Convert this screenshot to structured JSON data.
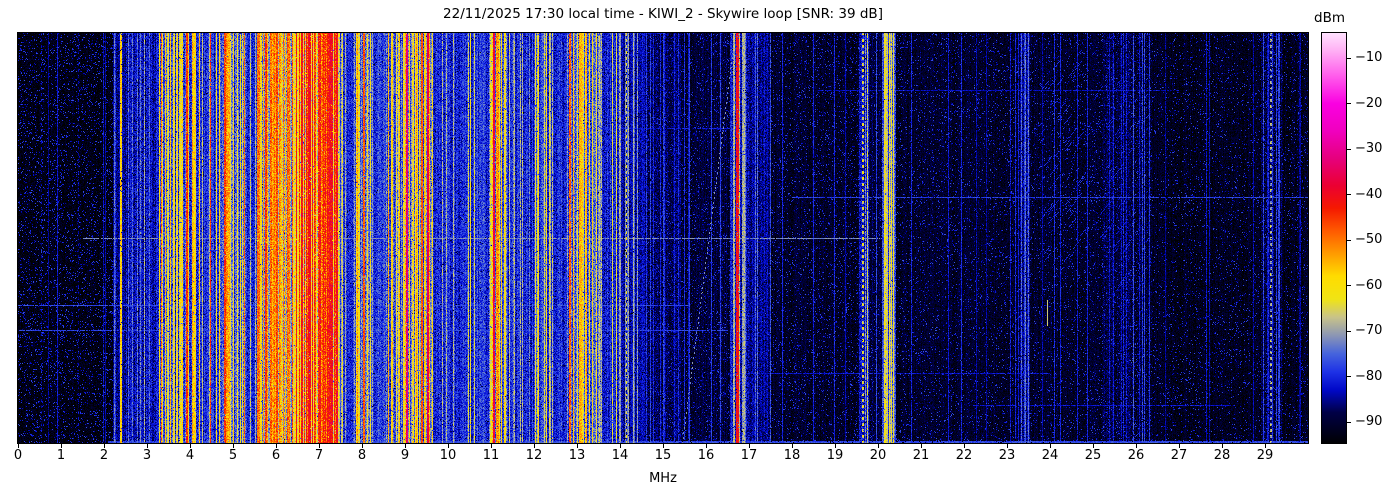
{
  "title": "22/11/2025 17:30 local time - KIWI_2 - Skywire loop [SNR: 39 dB]",
  "xlabel": "MHz",
  "colorbar": {
    "label": "dBm",
    "vmax": -4.5,
    "vmin": -94.6,
    "ticks": [
      {
        "v": -10,
        "label": "−10"
      },
      {
        "v": -20,
        "label": "−20"
      },
      {
        "v": -30,
        "label": "−30"
      },
      {
        "v": -40,
        "label": "−40"
      },
      {
        "v": -50,
        "label": "−50"
      },
      {
        "v": -60,
        "label": "−60"
      },
      {
        "v": -70,
        "label": "−70"
      },
      {
        "v": -80,
        "label": "−80"
      },
      {
        "v": -90,
        "label": "−90"
      }
    ]
  },
  "chart_data": {
    "type": "heatmap",
    "subtype": "radio-spectrogram-waterfall",
    "title": "22/11/2025 17:30 local time - KIWI_2 - Skywire loop [SNR: 39 dB]",
    "xlabel": "MHz",
    "value_label": "dBm",
    "x_range_mhz": [
      0,
      30
    ],
    "x_ticks": [
      0,
      1,
      2,
      3,
      4,
      5,
      6,
      7,
      8,
      9,
      10,
      11,
      12,
      13,
      14,
      15,
      16,
      17,
      18,
      19,
      20,
      21,
      22,
      23,
      24,
      25,
      26,
      27,
      28,
      29
    ],
    "value_range_dbm": [
      -94.6,
      -4.5
    ],
    "seed": 1337,
    "colormap": [
      {
        "v": -95,
        "c": "#000000"
      },
      {
        "v": -88,
        "c": "#000046"
      },
      {
        "v": -83,
        "c": "#0008c8"
      },
      {
        "v": -79,
        "c": "#1e32e6"
      },
      {
        "v": -75,
        "c": "#4664dc"
      },
      {
        "v": -71,
        "c": "#8c96b4"
      },
      {
        "v": -67,
        "c": "#c8c389"
      },
      {
        "v": -63,
        "c": "#f0e414"
      },
      {
        "v": -58,
        "c": "#ffdc00"
      },
      {
        "v": -53,
        "c": "#ff9b00"
      },
      {
        "v": -48,
        "c": "#ff5a00"
      },
      {
        "v": -43,
        "c": "#f51900"
      },
      {
        "v": -38,
        "c": "#eb0032"
      },
      {
        "v": -32,
        "c": "#e6007d"
      },
      {
        "v": -26,
        "c": "#f000be"
      },
      {
        "v": -20,
        "c": "#fa00e1"
      },
      {
        "v": -14,
        "c": "#ff5aeb"
      },
      {
        "v": -8,
        "c": "#ffb4f5"
      },
      {
        "v": -4,
        "c": "#ffe6ff"
      }
    ],
    "bands": [
      {
        "f0": 0.0,
        "f1": 2.2,
        "base": -93,
        "spread": 2,
        "density": 0.03,
        "line": -82,
        "line_var": 6,
        "v_noise": 3,
        "speckle": 0.1
      },
      {
        "f0": 2.2,
        "f1": 2.5,
        "base": -85,
        "spread": 5,
        "density": 0.12,
        "line": -77,
        "line_var": 6,
        "v_noise": 4,
        "speckle": 0.15
      },
      {
        "f0": 2.5,
        "f1": 3.25,
        "base": -83,
        "spread": 6,
        "density": 0.18,
        "line": -74,
        "line_var": 8,
        "v_noise": 5,
        "speckle": 0.15
      },
      {
        "f0": 3.25,
        "f1": 4.25,
        "base": -77,
        "spread": 8,
        "density": 0.48,
        "line": -60,
        "line_var": 14,
        "v_noise": 6,
        "speckle": 0.1
      },
      {
        "f0": 4.25,
        "f1": 4.65,
        "base": -80,
        "spread": 6,
        "density": 0.22,
        "line": -64,
        "line_var": 10,
        "v_noise": 5,
        "speckle": 0.1
      },
      {
        "f0": 4.65,
        "f1": 5.3,
        "base": -76,
        "spread": 8,
        "density": 0.42,
        "line": -58,
        "line_var": 16,
        "v_noise": 6,
        "speckle": 0.1
      },
      {
        "f0": 5.3,
        "f1": 5.55,
        "base": -80,
        "spread": 5,
        "density": 0.15,
        "line": -66,
        "line_var": 8,
        "v_noise": 5,
        "speckle": 0.1
      },
      {
        "f0": 5.55,
        "f1": 6.35,
        "base": -70,
        "spread": 8,
        "density": 0.6,
        "line": -55,
        "line_var": 14,
        "v_noise": 6,
        "speckle": 0.08
      },
      {
        "f0": 6.35,
        "f1": 7.45,
        "base": -62,
        "spread": 10,
        "density": 0.68,
        "line": -46,
        "line_var": 12,
        "v_noise": 6,
        "speckle": 0.08
      },
      {
        "f0": 7.45,
        "f1": 7.78,
        "base": -80,
        "spread": 6,
        "density": 0.18,
        "line": -66,
        "line_var": 8,
        "v_noise": 5,
        "speckle": 0.1
      },
      {
        "f0": 7.78,
        "f1": 8.2,
        "base": -74,
        "spread": 8,
        "density": 0.45,
        "line": -58,
        "line_var": 12,
        "v_noise": 6,
        "speckle": 0.08
      },
      {
        "f0": 8.2,
        "f1": 8.55,
        "base": -79,
        "spread": 7,
        "density": 0.25,
        "line": -66,
        "line_var": 10,
        "v_noise": 5,
        "speckle": 0.1
      },
      {
        "f0": 8.55,
        "f1": 9.1,
        "base": -75,
        "spread": 8,
        "density": 0.45,
        "line": -59,
        "line_var": 13,
        "v_noise": 6,
        "speckle": 0.08
      },
      {
        "f0": 9.1,
        "f1": 9.65,
        "base": -74,
        "spread": 8,
        "density": 0.5,
        "line": -58,
        "line_var": 13,
        "v_noise": 6,
        "speckle": 0.08
      },
      {
        "f0": 9.65,
        "f1": 10.4,
        "base": -80,
        "spread": 6,
        "density": 0.15,
        "line": -70,
        "line_var": 6,
        "v_noise": 5,
        "speckle": 0.12
      },
      {
        "f0": 10.4,
        "f1": 10.95,
        "base": -79,
        "spread": 7,
        "density": 0.25,
        "line": -64,
        "line_var": 10,
        "v_noise": 5,
        "speckle": 0.12
      },
      {
        "f0": 10.95,
        "f1": 11.35,
        "base": -75,
        "spread": 8,
        "density": 0.45,
        "line": -58,
        "line_var": 13,
        "v_noise": 6,
        "speckle": 0.08
      },
      {
        "f0": 11.35,
        "f1": 12.0,
        "base": -80,
        "spread": 6,
        "density": 0.15,
        "line": -70,
        "line_var": 8,
        "v_noise": 5,
        "speckle": 0.12
      },
      {
        "f0": 12.0,
        "f1": 12.3,
        "base": -78,
        "spread": 7,
        "density": 0.3,
        "line": -64,
        "line_var": 10,
        "v_noise": 5,
        "speckle": 0.1
      },
      {
        "f0": 12.3,
        "f1": 12.75,
        "base": -80,
        "spread": 6,
        "density": 0.2,
        "line": -68,
        "line_var": 8,
        "v_noise": 5,
        "speckle": 0.12
      },
      {
        "f0": 12.75,
        "f1": 13.45,
        "base": -76,
        "spread": 8,
        "density": 0.45,
        "line": -59,
        "line_var": 12,
        "v_noise": 6,
        "speckle": 0.08
      },
      {
        "f0": 13.45,
        "f1": 14.0,
        "base": -80,
        "spread": 6,
        "density": 0.25,
        "line": -68,
        "line_var": 8,
        "v_noise": 5,
        "speckle": 0.12
      },
      {
        "f0": 14.0,
        "f1": 14.6,
        "base": -84,
        "spread": 5,
        "density": 0.3,
        "line": -72,
        "line_var": 10,
        "v_noise": 4,
        "speckle": 0.12
      },
      {
        "f0": 14.6,
        "f1": 15.4,
        "base": -88,
        "spread": 4,
        "density": 0.15,
        "line": -78,
        "line_var": 6,
        "v_noise": 4,
        "speckle": 0.1
      },
      {
        "f0": 15.4,
        "f1": 16.55,
        "base": -90,
        "spread": 4,
        "density": 0.1,
        "line": -80,
        "line_var": 6,
        "v_noise": 3,
        "speckle": 0.09
      },
      {
        "f0": 16.55,
        "f1": 17.0,
        "base": -82,
        "spread": 6,
        "density": 0.3,
        "line": -72,
        "line_var": 8,
        "v_noise": 5,
        "speckle": 0.1
      },
      {
        "f0": 17.0,
        "f1": 17.5,
        "base": -85,
        "spread": 5,
        "density": 0.3,
        "line": -76,
        "line_var": 6,
        "v_noise": 4,
        "speckle": 0.1
      },
      {
        "f0": 17.5,
        "f1": 19.55,
        "base": -91,
        "spread": 3,
        "density": 0.06,
        "line": -82,
        "line_var": 5,
        "v_noise": 3,
        "speckle": 0.08
      },
      {
        "f0": 19.55,
        "f1": 19.78,
        "base": -82,
        "spread": 6,
        "density": 0.35,
        "line": -70,
        "line_var": 8,
        "v_noise": 5,
        "speckle": 0.1
      },
      {
        "f0": 19.78,
        "f1": 20.08,
        "base": -89,
        "spread": 4,
        "density": 0.08,
        "line": -80,
        "line_var": 5,
        "v_noise": 3,
        "speckle": 0.08
      },
      {
        "f0": 20.08,
        "f1": 20.4,
        "base": -76,
        "spread": 7,
        "density": 0.5,
        "line": -66,
        "line_var": 8,
        "v_noise": 5,
        "speckle": 0.08
      },
      {
        "f0": 20.4,
        "f1": 23.3,
        "base": -91,
        "spread": 3,
        "density": 0.05,
        "line": -82,
        "line_var": 5,
        "v_noise": 3,
        "speckle": 0.07
      },
      {
        "f0": 23.3,
        "f1": 23.52,
        "base": -85,
        "spread": 5,
        "density": 0.3,
        "line": -77,
        "line_var": 6,
        "v_noise": 4,
        "speckle": 0.09
      },
      {
        "f0": 23.52,
        "f1": 25.2,
        "base": -91,
        "spread": 3,
        "density": 0.06,
        "line": -82,
        "line_var": 5,
        "v_noise": 3,
        "speckle": 0.07
      },
      {
        "f0": 25.2,
        "f1": 26.35,
        "base": -89,
        "spread": 4,
        "density": 0.22,
        "line": -79,
        "line_var": 7,
        "v_noise": 4,
        "speckle": 0.09
      },
      {
        "f0": 26.35,
        "f1": 28.9,
        "base": -92,
        "spread": 3,
        "density": 0.05,
        "line": -83,
        "line_var": 5,
        "v_noise": 3,
        "speckle": 0.06
      },
      {
        "f0": 28.9,
        "f1": 29.4,
        "base": -89,
        "spread": 4,
        "density": 0.18,
        "line": -80,
        "line_var": 6,
        "v_noise": 4,
        "speckle": 0.09
      },
      {
        "f0": 29.4,
        "f1": 30.0,
        "base": -92,
        "spread": 3,
        "density": 0.05,
        "line": -84,
        "line_var": 5,
        "v_noise": 3,
        "speckle": 0.06
      }
    ],
    "features": {
      "vlines": [
        {
          "f": 0.55,
          "w": 1,
          "level": -84,
          "var": 4,
          "dot": true
        },
        {
          "f": 1.4,
          "w": 1,
          "level": -85,
          "var": 4,
          "dot": true
        },
        {
          "f": 1.98,
          "w": 1,
          "level": -83,
          "var": 4
        },
        {
          "f": 2.26,
          "w": 1,
          "level": -79,
          "var": 5
        },
        {
          "f": 2.4,
          "w": 2,
          "level": -58,
          "var": 6
        },
        {
          "f": 3.33,
          "w": 1,
          "level": -50,
          "var": 8
        },
        {
          "f": 3.94,
          "w": 2,
          "level": -44,
          "var": 6
        },
        {
          "f": 4.47,
          "w": 1,
          "level": -46,
          "var": 6
        },
        {
          "f": 4.82,
          "w": 2,
          "level": -45,
          "var": 6
        },
        {
          "f": 5.76,
          "w": 2,
          "level": -45,
          "var": 6
        },
        {
          "f": 6.02,
          "w": 2,
          "level": -47,
          "var": 6
        },
        {
          "f": 6.6,
          "w": 2,
          "level": -42,
          "var": 5
        },
        {
          "f": 6.79,
          "w": 3,
          "level": -40,
          "var": 5
        },
        {
          "f": 7.0,
          "w": 2,
          "level": -44,
          "var": 6
        },
        {
          "f": 7.21,
          "w": 2,
          "level": -44,
          "var": 6
        },
        {
          "f": 8.04,
          "w": 2,
          "level": -48,
          "var": 6
        },
        {
          "f": 9.04,
          "w": 2,
          "level": -33,
          "var": 4
        },
        {
          "f": 9.4,
          "w": 2,
          "level": -47,
          "var": 5
        },
        {
          "f": 9.53,
          "w": 2,
          "level": -36,
          "var": 4
        },
        {
          "f": 11.06,
          "w": 2,
          "level": -37,
          "var": 5
        },
        {
          "f": 11.17,
          "w": 2,
          "level": -52,
          "var": 6
        },
        {
          "f": 12.84,
          "w": 2,
          "level": -48,
          "var": 6
        },
        {
          "f": 13.1,
          "w": 3,
          "level": -58,
          "var": 6
        },
        {
          "f": 14.16,
          "w": 1,
          "level": -63,
          "var": 6,
          "dot": true
        },
        {
          "f": 16.74,
          "w": 3,
          "level": -41,
          "var": 4
        },
        {
          "f": 16.88,
          "w": 2,
          "level": -69,
          "var": 4
        },
        {
          "f": 17.15,
          "w": 1,
          "level": -76,
          "var": 5
        },
        {
          "f": 19.65,
          "w": 2,
          "level": -64,
          "var": 6,
          "dot": true
        },
        {
          "f": 20.2,
          "w": 2,
          "level": -67,
          "var": 5
        },
        {
          "f": 23.07,
          "w": 1,
          "level": -82,
          "var": 4
        },
        {
          "f": 23.4,
          "w": 1,
          "level": -78,
          "var": 4
        },
        {
          "f": 25.95,
          "w": 1,
          "level": -77,
          "var": 4
        },
        {
          "f": 26.15,
          "w": 1,
          "level": -78,
          "var": 4
        },
        {
          "f": 29.15,
          "w": 2,
          "level": -70,
          "var": 7,
          "dot": true
        }
      ],
      "hlines": [
        {
          "y": 205,
          "x0": 0.05,
          "x1": 0.67,
          "level": -72
        },
        {
          "y": 164,
          "x0": 0.6,
          "x1": 1.0,
          "level": -78
        },
        {
          "y": 272,
          "x0": 0.0,
          "x1": 0.52,
          "level": -77
        },
        {
          "y": 297,
          "x0": 0.0,
          "x1": 0.55,
          "level": -78
        },
        {
          "y": 95,
          "x0": 0.3,
          "x1": 0.56,
          "level": -81
        },
        {
          "y": 57,
          "x0": 0.62,
          "x1": 0.9,
          "level": -83
        },
        {
          "y": 340,
          "x0": 0.55,
          "x1": 0.8,
          "level": -82
        },
        {
          "y": 372,
          "x0": 0.74,
          "x1": 0.94,
          "level": -82
        },
        {
          "y": 0,
          "x0": 0.08,
          "x1": 0.5,
          "level": -83
        },
        {
          "y": 408,
          "x0": 0.07,
          "x1": 1.0,
          "level": -78
        },
        {
          "y": 409,
          "x0": 0.07,
          "x1": 1.0,
          "level": -77
        }
      ],
      "diagonals": [
        {
          "x0": 664,
          "y0": 410,
          "x1": 717,
          "y1": 0,
          "level": -72,
          "dash": [
            2,
            3
          ]
        },
        {
          "x0": 690,
          "y0": 410,
          "x1": 742,
          "y1": 0,
          "level": -80,
          "dash": [
            1,
            5
          ]
        },
        {
          "x0": 640,
          "y0": 410,
          "x1": 672,
          "y1": 200,
          "level": -80,
          "dash": [
            1,
            6
          ]
        }
      ],
      "hatches": [
        {
          "x0": 1022,
          "y0": 20,
          "x1": 1062,
          "y1": 230,
          "level": -80,
          "count": 45
        },
        {
          "x0": 1075,
          "y0": 50,
          "x1": 1110,
          "y1": 270,
          "level": -81,
          "count": 30
        }
      ],
      "segments": [
        {
          "x": 1029,
          "y0": 267,
          "y1": 292,
          "level": -66
        }
      ]
    }
  }
}
